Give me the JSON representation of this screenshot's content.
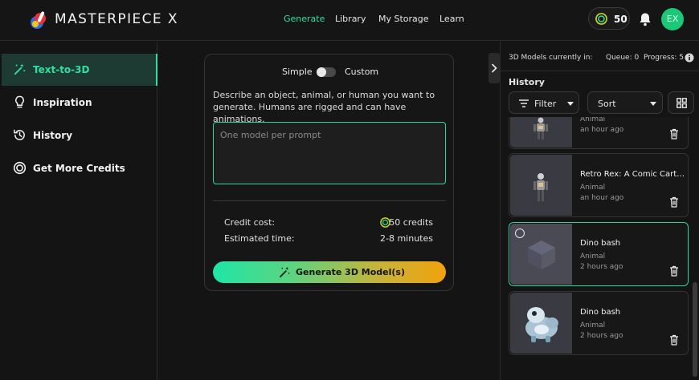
{
  "brand": {
    "name": "MASTERPIECE X"
  },
  "nav": {
    "items": [
      "Generate",
      "Library",
      "My Storage",
      "Learn"
    ],
    "active": "Generate"
  },
  "header": {
    "credits": "50",
    "avatar_initials": "EX"
  },
  "sidebar": {
    "items": [
      {
        "label": "Text-to-3D",
        "icon": "magic-wand-icon"
      },
      {
        "label": "Inspiration",
        "icon": "lightbulb-icon"
      },
      {
        "label": "History",
        "icon": "history-icon"
      },
      {
        "label": "Get More Credits",
        "icon": "coin-icon"
      }
    ]
  },
  "generator": {
    "mode_simple": "Simple",
    "mode_custom": "Custom",
    "description": "Describe an object, animal, or human you want to generate. Humans are rigged and can have animations.",
    "prompt_placeholder": "One model per prompt",
    "prompt_value": "",
    "credit_cost_label": "Credit cost:",
    "credit_cost_value": "50 credits",
    "estimated_time_label": "Estimated time:",
    "estimated_time_value": "2-8 minutes",
    "generate_label": "Generate 3D Model(s)"
  },
  "queue": {
    "current_label": "3D Models currently in:",
    "queue_label": "Queue: 0",
    "progress_label": "Progress: 5"
  },
  "history": {
    "title": "History",
    "filter_label": "Filter",
    "sort_label": "Sort",
    "items": [
      {
        "name": "",
        "category": "Animal",
        "time": "an hour ago",
        "thumb": "robot-figure"
      },
      {
        "name": "Retro Rex: A Comic Cartoon",
        "category": "Animal",
        "time": "an hour ago",
        "thumb": "robot-figure"
      },
      {
        "name": "Dino bash",
        "category": "Animal",
        "time": "2 hours ago",
        "thumb": "placeholder-cube"
      },
      {
        "name": "Dino bash",
        "category": "Animal",
        "time": "2 hours ago",
        "thumb": "cartoon-dino"
      }
    ]
  },
  "colors": {
    "accent": "#2fe0a0",
    "background": "#141414",
    "avatar": "#19c977"
  }
}
